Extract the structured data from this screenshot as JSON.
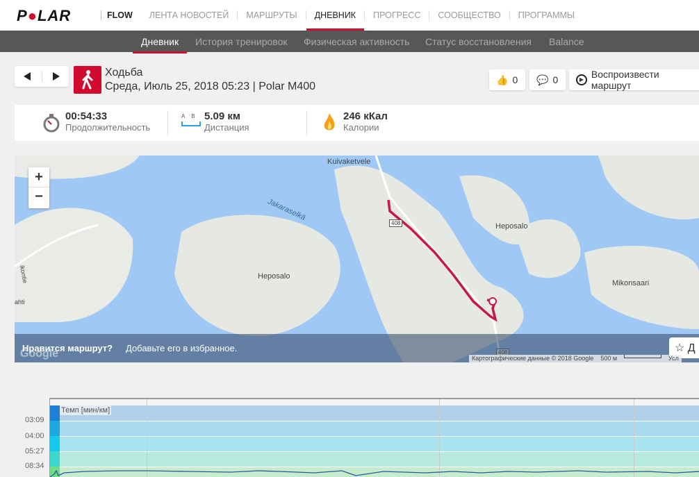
{
  "brand": {
    "logo": "POLAR",
    "product": "FLOW"
  },
  "nav": [
    "ЛЕНТА НОВОСТЕЙ",
    "МАРШРУТЫ",
    "ДНЕВНИК",
    "ПРОГРЕСС",
    "СООБЩЕСТВО",
    "ПРОГРАММЫ"
  ],
  "subnav": [
    "Дневник",
    "История тренировок",
    "Физическая активность",
    "Статус восстановления",
    "Balance"
  ],
  "session": {
    "sport": "Ходьба",
    "date": "Среда, Июль 25, 2018 05:23 | Polar M400",
    "likes": "0",
    "comments": "0",
    "replay": "Воспроизвести маршрут"
  },
  "stats": {
    "duration": "00:54:33",
    "duration_label": "Продолжительность",
    "distance": "5.09 км",
    "distance_label": "Дистанция",
    "calories": "246 кКал",
    "calories_label": "Калории",
    "ab_a": "A",
    "ab_b": "B"
  },
  "map": {
    "places": [
      "Kuivaketvele",
      "Jakaraselkä",
      "Heposalo",
      "Heposalo",
      "Mikonsaari",
      "ahti",
      "ikontie"
    ],
    "roads": [
      "408",
      "408"
    ],
    "zoom_in": "+",
    "zoom_out": "−",
    "banner_bold": "Нравится маршрут?",
    "banner_text": "Добавьте его в избранное.",
    "favorite": "Д",
    "attribution": "Картографические данные © 2018 Google",
    "scale": "500 м",
    "terms": "Усл",
    "google": "Google",
    "route_color": "#c8174a"
  },
  "chart": {
    "legend": "Темп [мин/км]",
    "yticks": [
      "03:09",
      "04:00",
      "05:27",
      "08:34"
    ]
  }
}
